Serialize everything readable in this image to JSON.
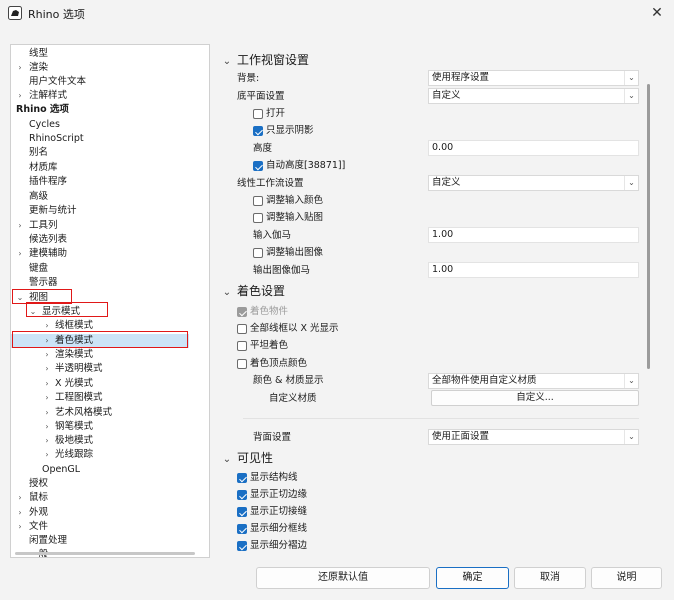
{
  "window": {
    "title": "Rhino 选项",
    "icon": "rhino-app-icon",
    "close": "✕"
  },
  "tree": {
    "items": [
      {
        "label": "线型",
        "arrow": ""
      },
      {
        "label": "渲染",
        "arrow": "›"
      },
      {
        "label": "用户文件文本",
        "arrow": ""
      },
      {
        "label": "注解样式",
        "arrow": "›"
      },
      {
        "label": "Rhino 选项",
        "arrow": ""
      },
      {
        "label": "Cycles",
        "arrow": ""
      },
      {
        "label": "RhinoScript",
        "arrow": ""
      },
      {
        "label": "别名",
        "arrow": ""
      },
      {
        "label": "材质库",
        "arrow": ""
      },
      {
        "label": "插件程序",
        "arrow": ""
      },
      {
        "label": "高级",
        "arrow": ""
      },
      {
        "label": "更新与统计",
        "arrow": ""
      },
      {
        "label": "工具列",
        "arrow": "›"
      },
      {
        "label": "候选列表",
        "arrow": ""
      },
      {
        "label": "建模辅助",
        "arrow": "›"
      },
      {
        "label": "键盘",
        "arrow": ""
      },
      {
        "label": "警示器",
        "arrow": ""
      },
      {
        "label": "视图",
        "arrow": "⌄"
      },
      {
        "label": "显示模式",
        "arrow": "⌄"
      },
      {
        "label": "线框模式",
        "arrow": "›"
      },
      {
        "label": "着色模式",
        "arrow": "›"
      },
      {
        "label": "渲染模式",
        "arrow": "›"
      },
      {
        "label": "半透明模式",
        "arrow": "›"
      },
      {
        "label": "X 光模式",
        "arrow": "›"
      },
      {
        "label": "工程图模式",
        "arrow": "›"
      },
      {
        "label": "艺术风格模式",
        "arrow": "›"
      },
      {
        "label": "钢笔模式",
        "arrow": "›"
      },
      {
        "label": "极地模式",
        "arrow": "›"
      },
      {
        "label": "光线跟踪",
        "arrow": "›"
      },
      {
        "label": "OpenGL",
        "arrow": ""
      },
      {
        "label": "授权",
        "arrow": ""
      },
      {
        "label": "鼠标",
        "arrow": "›"
      },
      {
        "label": "外观",
        "arrow": "›"
      },
      {
        "label": "文件",
        "arrow": "›"
      },
      {
        "label": "闲置处理",
        "arrow": ""
      },
      {
        "label": "一般",
        "arrow": ""
      }
    ]
  },
  "viewport": {
    "header": "工作视窗设置",
    "background_label": "背景:",
    "background_value": "使用程序设置",
    "ground_plane_label": "底平面设置",
    "ground_plane_value": "自定义",
    "on_label": "打开",
    "shadows_only_label": "只显示阴影",
    "height_label": "高度",
    "height_value": "0.00",
    "auto_height_label": "自动高度[38871]]",
    "linear_workflow_label": "线性工作流设置",
    "linear_workflow_value": "自定义",
    "adjust_input_color_label": "调整输入颜色",
    "adjust_input_texture_label": "调整输入贴图",
    "input_gamma_label": "输入伽马",
    "input_gamma_value": "1.00",
    "adjust_output_image_label": "调整输出图像",
    "output_gamma_label": "输出图像伽马",
    "output_gamma_value": "1.00"
  },
  "shading": {
    "header": "着色设置",
    "shade_objects_label": "着色物件",
    "xray_all_label": "全部线框以 X 光显示",
    "flat_shading_label": "平坦着色",
    "vertex_color_label": "着色顶点颜色",
    "color_material_label": "颜色 & 材质显示",
    "color_material_value": "全部物件使用自定义材质",
    "custom_material_label": "自定义材质",
    "custom_button": "自定义...",
    "backface_label": "背面设置",
    "backface_value": "使用正面设置"
  },
  "visibility": {
    "header": "可见性",
    "items": [
      "显示结构线",
      "显示正切边缘",
      "显示正切接缝",
      "显示细分框线",
      "显示细分褶边"
    ]
  },
  "buttons": {
    "restore": "还原默认值",
    "ok": "确定",
    "cancel": "取消",
    "help": "说明"
  },
  "colors": {
    "accent": "#1a6fc4",
    "selection": "#cce4f7",
    "annotation": "#e01818"
  }
}
